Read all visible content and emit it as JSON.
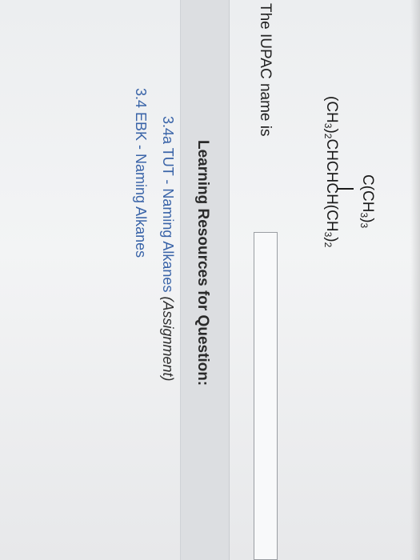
{
  "question": {
    "structure": {
      "top_group": "C(CH3)3",
      "main_chain": "(CH3)2CHCHCH(CH3)2"
    },
    "prompt": "The IUPAC name is",
    "answer_value": ""
  },
  "resources": {
    "title": "Learning Resources for Question:",
    "links": [
      {
        "label": "3.4a TUT - Naming Alkanes",
        "suffix": "(Assignment)"
      },
      {
        "label": "3.4 EBK - Naming Alkanes"
      }
    ]
  }
}
